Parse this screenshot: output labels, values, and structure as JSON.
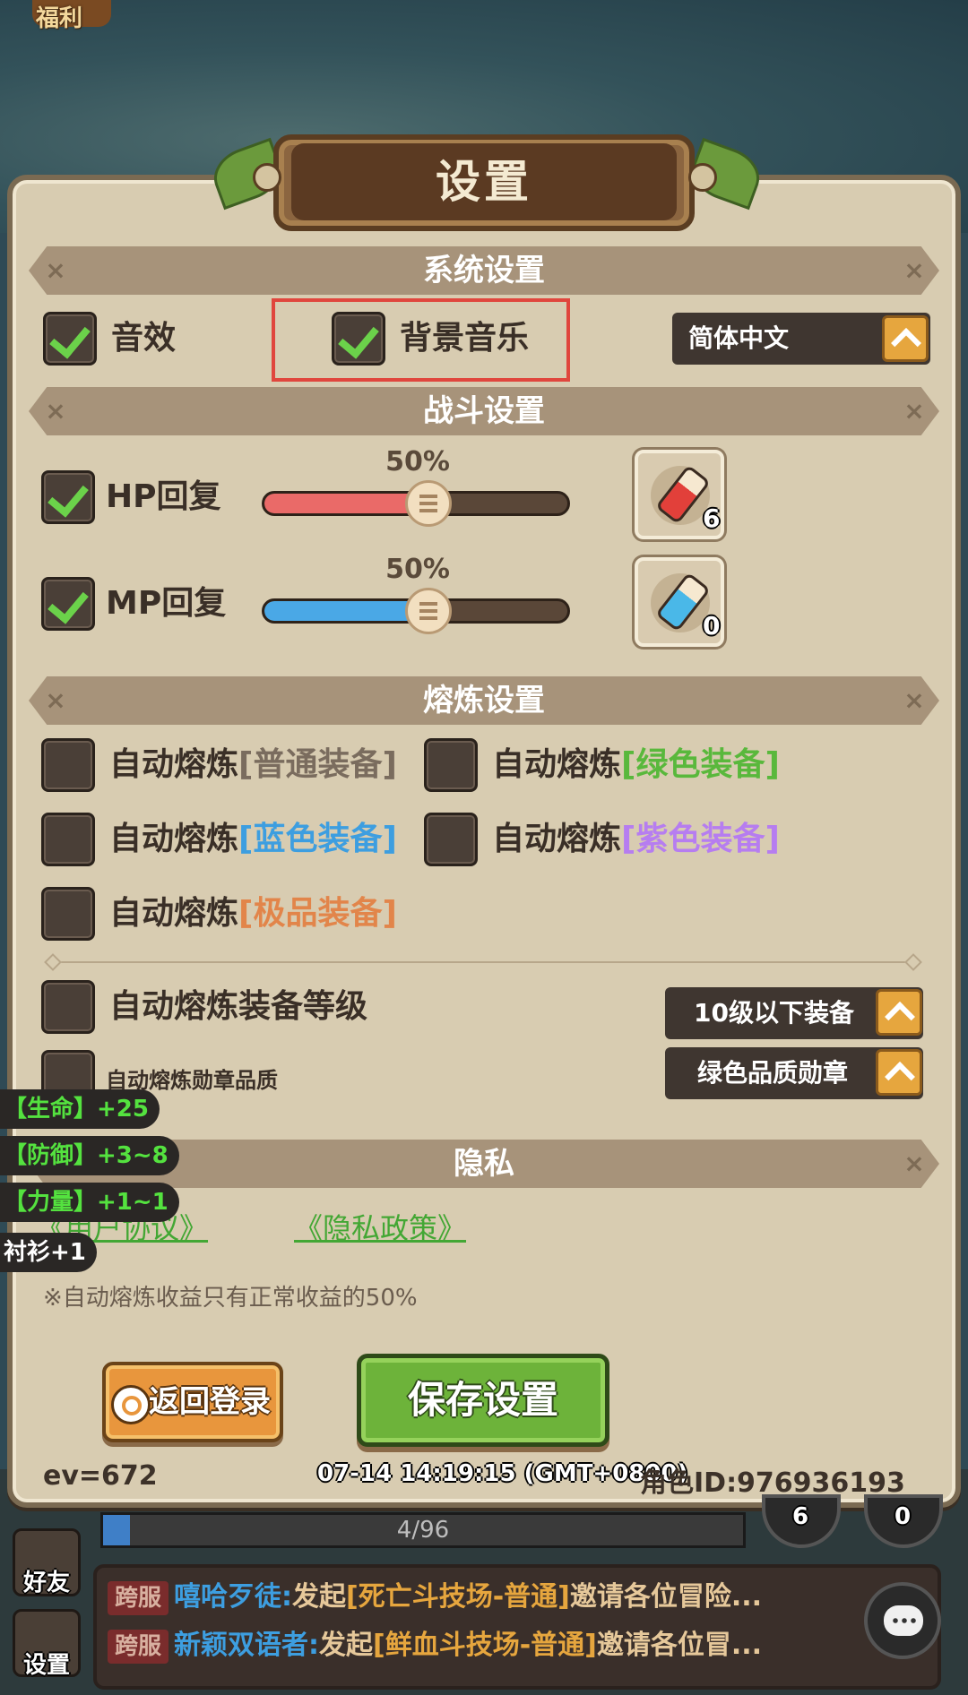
{
  "background": {
    "welfare_label": "福利"
  },
  "dialog": {
    "title": "设置",
    "system": {
      "header": "系统设置",
      "sound_effects": {
        "label": "音效",
        "checked": true
      },
      "background_music": {
        "label": "背景音乐",
        "checked": true
      },
      "language": {
        "value": "简体中文"
      }
    },
    "battle": {
      "header": "战斗设置",
      "hp": {
        "label": "HP回复",
        "checked": true,
        "percent_text": "50%",
        "level": 0.5,
        "potion_count": "6"
      },
      "mp": {
        "label": "MP回复",
        "checked": true,
        "percent_text": "50%",
        "level": 0.5,
        "potion_count": "0"
      }
    },
    "smelt": {
      "header": "熔炼设置",
      "prefix": "自动熔炼",
      "options": [
        {
          "tag": "[普通装备]",
          "checked": false
        },
        {
          "tag": "[绿色装备]",
          "checked": false
        },
        {
          "tag": "[蓝色装备]",
          "checked": false
        },
        {
          "tag": "[紫色装备]",
          "checked": false
        },
        {
          "tag": "[极品装备]",
          "checked": false
        }
      ],
      "level_label": "自动熔炼装备等级",
      "level_checked": false,
      "level_dropdown": "10级以下装备",
      "medal_label": "自动熔炼勋章品质",
      "medal_checked": false,
      "medal_dropdown": "绿色品质勋章"
    },
    "privacy": {
      "header": "隐私",
      "user_agreement": "《用户协议》",
      "privacy_policy": "《隐私政策》"
    },
    "note": "※自动熔炼收益只有正常收益的50%",
    "buttons": {
      "back_login": "返回登录",
      "save": "保存设置"
    },
    "footer": {
      "ev": "ev=672",
      "time": "07-14 14:19:15 (GMT+0800)",
      "role_id": "角色ID:976936193"
    }
  },
  "buffs": [
    "【生命】+25",
    "【防御】+3~8",
    "【力量】+1~1",
    "衬衫+1"
  ],
  "game_ui": {
    "friends_label": "好友",
    "settings_label": "设置",
    "exp_text": "4/96",
    "exp_fraction": 0.0417,
    "left_badge": "6",
    "right_badge": "0",
    "chat": [
      {
        "channel": "跨服",
        "name": "嘻哈歹徒:",
        "action": "发起",
        "event": "[死亡斗技场-普通]",
        "tail": "邀请各位冒险..."
      },
      {
        "channel": "跨服",
        "name": "新颖双语者:",
        "action": "发起",
        "event": "[鲜血斗技场-普通]",
        "tail": "邀请各位冒..."
      }
    ]
  },
  "colors": {
    "hp_fill": "#ea6a68",
    "mp_fill": "#4aa8e6",
    "accent_orange": "#e6a63e",
    "save_green": "#6db33a"
  }
}
